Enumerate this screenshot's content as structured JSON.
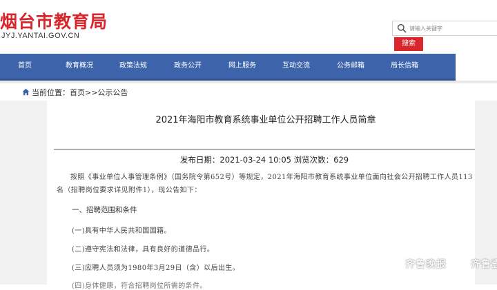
{
  "site": {
    "title": "烟台市教育局",
    "domain": "JYJ.YANTAI.GOV.CN"
  },
  "search": {
    "placeholder": "请输入关键字",
    "button_label": "搜索"
  },
  "nav": {
    "items": [
      {
        "label": "首页"
      },
      {
        "label": "教育概况"
      },
      {
        "label": "政策法规"
      },
      {
        "label": "政务公开"
      },
      {
        "label": "网上服务"
      },
      {
        "label": "互动交流"
      },
      {
        "label": "公务邮箱"
      },
      {
        "label": "局长信箱"
      }
    ]
  },
  "breadcrumb": {
    "text": "当前位置：首页>>公示公告"
  },
  "article": {
    "title": "2021年海阳市教育系统事业单位公开招聘工作人员简章",
    "meta": "发布日期：2021-03-24 10:05    浏览次数：629",
    "intro": "按照《事业单位人事管理条例》（国务院令第652号）等规定，2021年海阳市教育系统事业单位面向社会公开招聘工作人员113名（招聘岗位要求详见附件1），现公告如下：",
    "section1": "一、招聘范围和条件",
    "items": [
      "(一)具有中华人民共和国国籍。",
      "(二)遵守宪法和法律，具有良好的道德品行。",
      "(三)应聘人员须为1980年3月29日（含）以后出生。",
      "(四)身体健康，符合招聘岗位所需的条件。"
    ]
  },
  "watermark": {
    "left": "齐鲁晚报",
    "right": "齐鲁壹点"
  },
  "colors": {
    "brand_red": "#d8262c",
    "nav_blue": "#3d64aa"
  }
}
